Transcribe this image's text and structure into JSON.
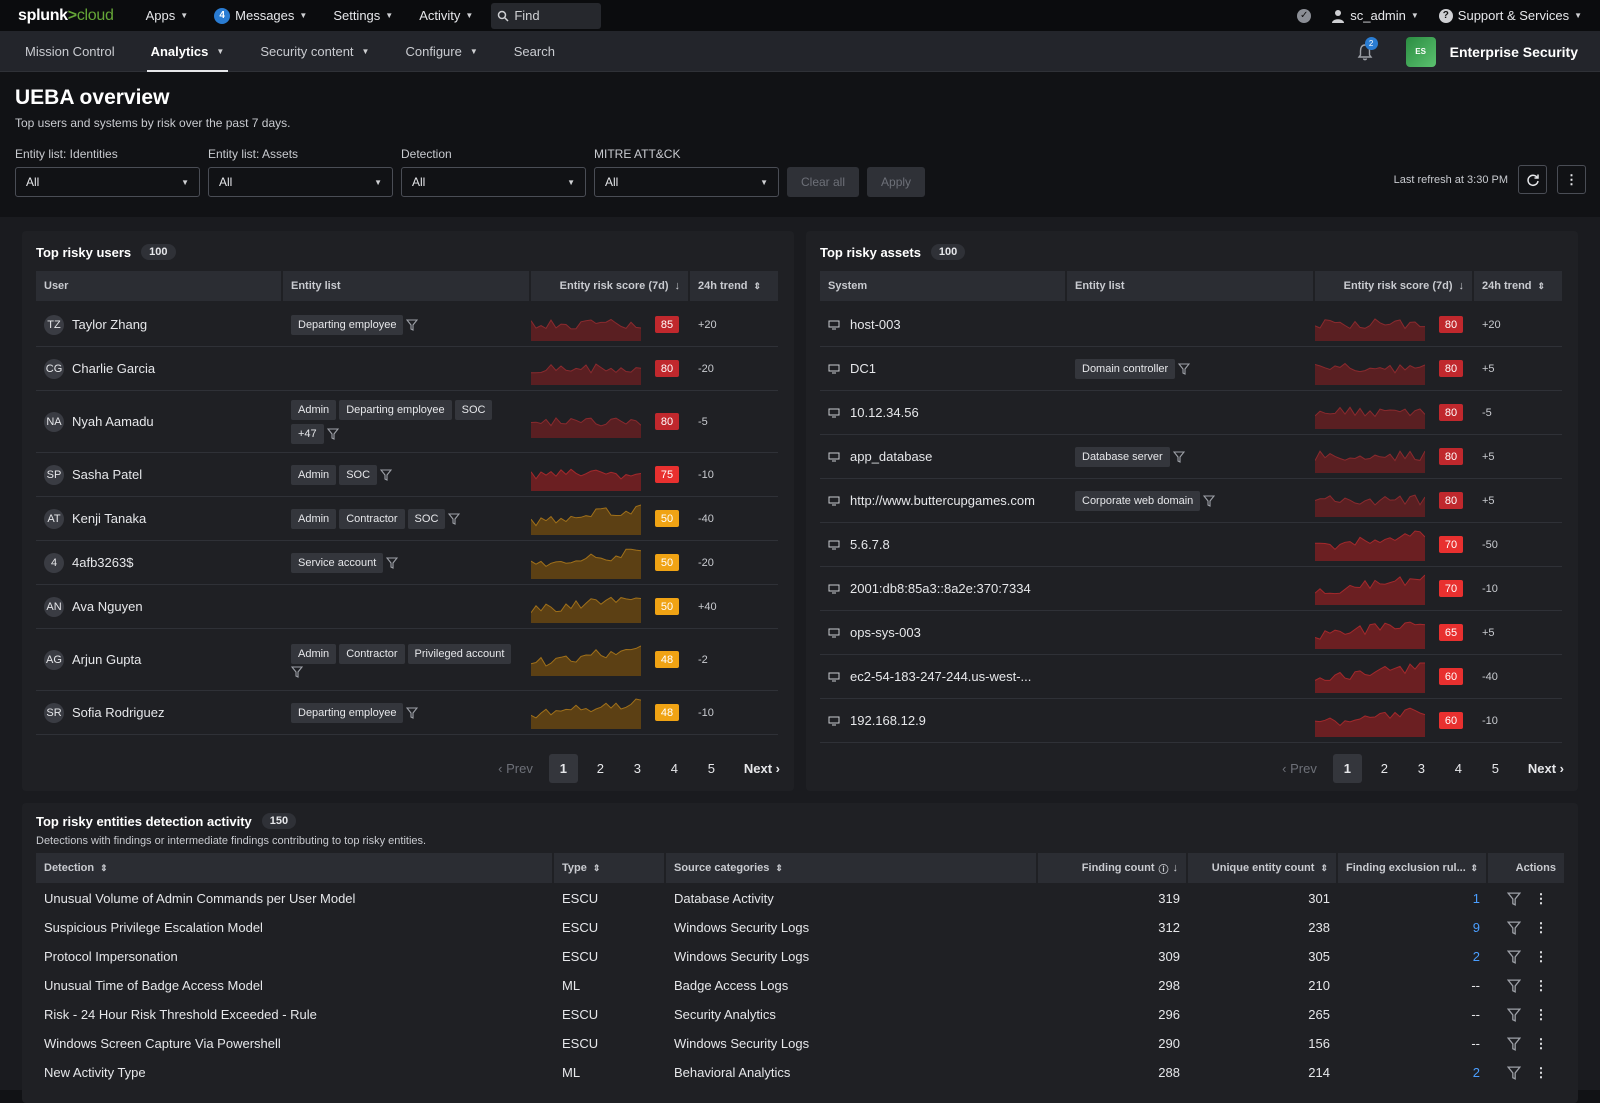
{
  "app": {
    "brand_main": "splunk",
    "brand_sep": ">",
    "brand_sub": "cloud"
  },
  "topnav": {
    "apps": "Apps",
    "messages_count": "4",
    "messages": "Messages",
    "settings": "Settings",
    "activity": "Activity",
    "find": "Find",
    "user": "sc_admin",
    "support": "Support & Services"
  },
  "subnav": {
    "items": [
      "Mission Control",
      "Analytics",
      "Security content",
      "Configure",
      "Search"
    ],
    "notifications": "2",
    "app_icon": "ES",
    "app_title": "Enterprise Security"
  },
  "page": {
    "title": "UEBA overview",
    "subtitle": "Top users and systems by risk over the past 7 days.",
    "filters": [
      {
        "label": "Entity list: Identities",
        "value": "All"
      },
      {
        "label": "Entity list: Assets",
        "value": "All"
      },
      {
        "label": "Detection",
        "value": "All"
      },
      {
        "label": "MITRE ATT&CK",
        "value": "All"
      }
    ],
    "clear_all": "Clear all",
    "apply": "Apply",
    "last_refresh": "Last refresh at 3:30 PM"
  },
  "colors": {
    "critical": "#c0282d",
    "high": "#e8302f",
    "medium": "#f0a314",
    "link": "#4a9eff"
  },
  "users": {
    "title": "Top risky users",
    "count": "100",
    "columns": [
      "User",
      "Entity list",
      "Entity risk score (7d)",
      "24h trend"
    ],
    "rows": [
      {
        "initials": "TZ",
        "name": "Taylor Zhang",
        "tags": [
          "Departing employee"
        ],
        "score": "85",
        "trend": "+20",
        "level": "critical"
      },
      {
        "initials": "CG",
        "name": "Charlie Garcia",
        "tags": [],
        "score": "80",
        "trend": "-20",
        "level": "critical"
      },
      {
        "initials": "NA",
        "name": "Nyah Aamadu",
        "tags": [
          "Admin",
          "Departing employee",
          "SOC",
          "+47"
        ],
        "score": "80",
        "trend": "-5",
        "level": "critical"
      },
      {
        "initials": "SP",
        "name": "Sasha Patel",
        "tags": [
          "Admin",
          "SOC"
        ],
        "score": "75",
        "trend": "-10",
        "level": "high"
      },
      {
        "initials": "AT",
        "name": "Kenji Tanaka",
        "tags": [
          "Admin",
          "Contractor",
          "SOC"
        ],
        "score": "50",
        "trend": "-40",
        "level": "medium"
      },
      {
        "initials": "4",
        "name": "4afb3263$",
        "tags": [
          "Service account"
        ],
        "score": "50",
        "trend": "-20",
        "level": "medium"
      },
      {
        "initials": "AN",
        "name": "Ava Nguyen",
        "tags": [],
        "score": "50",
        "trend": "+40",
        "level": "medium"
      },
      {
        "initials": "AG",
        "name": "Arjun Gupta",
        "tags": [
          "Admin",
          "Contractor",
          "Privileged account"
        ],
        "score": "48",
        "trend": "-2",
        "level": "medium"
      },
      {
        "initials": "SR",
        "name": "Sofia Rodriguez",
        "tags": [
          "Departing employee"
        ],
        "score": "48",
        "trend": "-10",
        "level": "medium"
      }
    ]
  },
  "assets": {
    "title": "Top risky assets",
    "count": "100",
    "columns": [
      "System",
      "Entity list",
      "Entity risk score (7d)",
      "24h trend"
    ],
    "rows": [
      {
        "name": "host-003",
        "tags": [],
        "score": "80",
        "trend": "+20",
        "level": "critical"
      },
      {
        "name": "DC1",
        "tags": [
          "Domain controller"
        ],
        "score": "80",
        "trend": "+5",
        "level": "critical"
      },
      {
        "name": "10.12.34.56",
        "tags": [],
        "score": "80",
        "trend": "-5",
        "level": "critical"
      },
      {
        "name": "app_database",
        "tags": [
          "Database server"
        ],
        "score": "80",
        "trend": "+5",
        "level": "critical"
      },
      {
        "name": "http://www.buttercupgames.com",
        "tags": [
          "Corporate web domain"
        ],
        "score": "80",
        "trend": "+5",
        "level": "critical"
      },
      {
        "name": "5.6.7.8",
        "tags": [],
        "score": "70",
        "trend": "-50",
        "level": "high"
      },
      {
        "name": "2001:db8:85a3::8a2e:370:7334",
        "tags": [],
        "score": "70",
        "trend": "-10",
        "level": "high"
      },
      {
        "name": "ops-sys-003",
        "tags": [],
        "score": "65",
        "trend": "+5",
        "level": "high"
      },
      {
        "name": "ec2-54-183-247-244.us-west-...",
        "tags": [],
        "score": "60",
        "trend": "-40",
        "level": "high"
      },
      {
        "name": "192.168.12.9",
        "tags": [],
        "score": "60",
        "trend": "-10",
        "level": "high"
      }
    ]
  },
  "pager": {
    "prev": "Prev",
    "next": "Next",
    "pages": [
      "1",
      "2",
      "3",
      "4",
      "5"
    ]
  },
  "detections": {
    "title": "Top risky entities detection activity",
    "count": "150",
    "subtitle": "Detections with findings or intermediate findings contributing to top risky entities.",
    "columns": [
      "Detection",
      "Type",
      "Source categories",
      "Finding count",
      "Unique entity count",
      "Finding exclusion rul...",
      "Actions"
    ],
    "rows": [
      {
        "name": "Unusual Volume of Admin Commands per User Model",
        "type": "ESCU",
        "source": "Database Activity",
        "findings": "319",
        "unique": "301",
        "excl": "1"
      },
      {
        "name": "Suspicious Privilege Escalation Model",
        "type": "ESCU",
        "source": "Windows Security Logs",
        "findings": "312",
        "unique": "238",
        "excl": "9"
      },
      {
        "name": "Protocol Impersonation",
        "type": "ESCU",
        "source": "Windows Security Logs",
        "findings": "309",
        "unique": "305",
        "excl": "2"
      },
      {
        "name": "Unusual Time of Badge Access Model",
        "type": "ML",
        "source": "Badge Access Logs",
        "findings": "298",
        "unique": "210",
        "excl": "--"
      },
      {
        "name": "Risk - 24 Hour Risk Threshold Exceeded - Rule",
        "type": "ESCU",
        "source": "Security Analytics",
        "findings": "296",
        "unique": "265",
        "excl": "--"
      },
      {
        "name": "Windows Screen Capture Via Powershell",
        "type": "ESCU",
        "source": "Windows Security Logs",
        "findings": "290",
        "unique": "156",
        "excl": "--"
      },
      {
        "name": "New Activity Type",
        "type": "ML",
        "source": "Behavioral Analytics",
        "findings": "288",
        "unique": "214",
        "excl": "2"
      }
    ]
  }
}
